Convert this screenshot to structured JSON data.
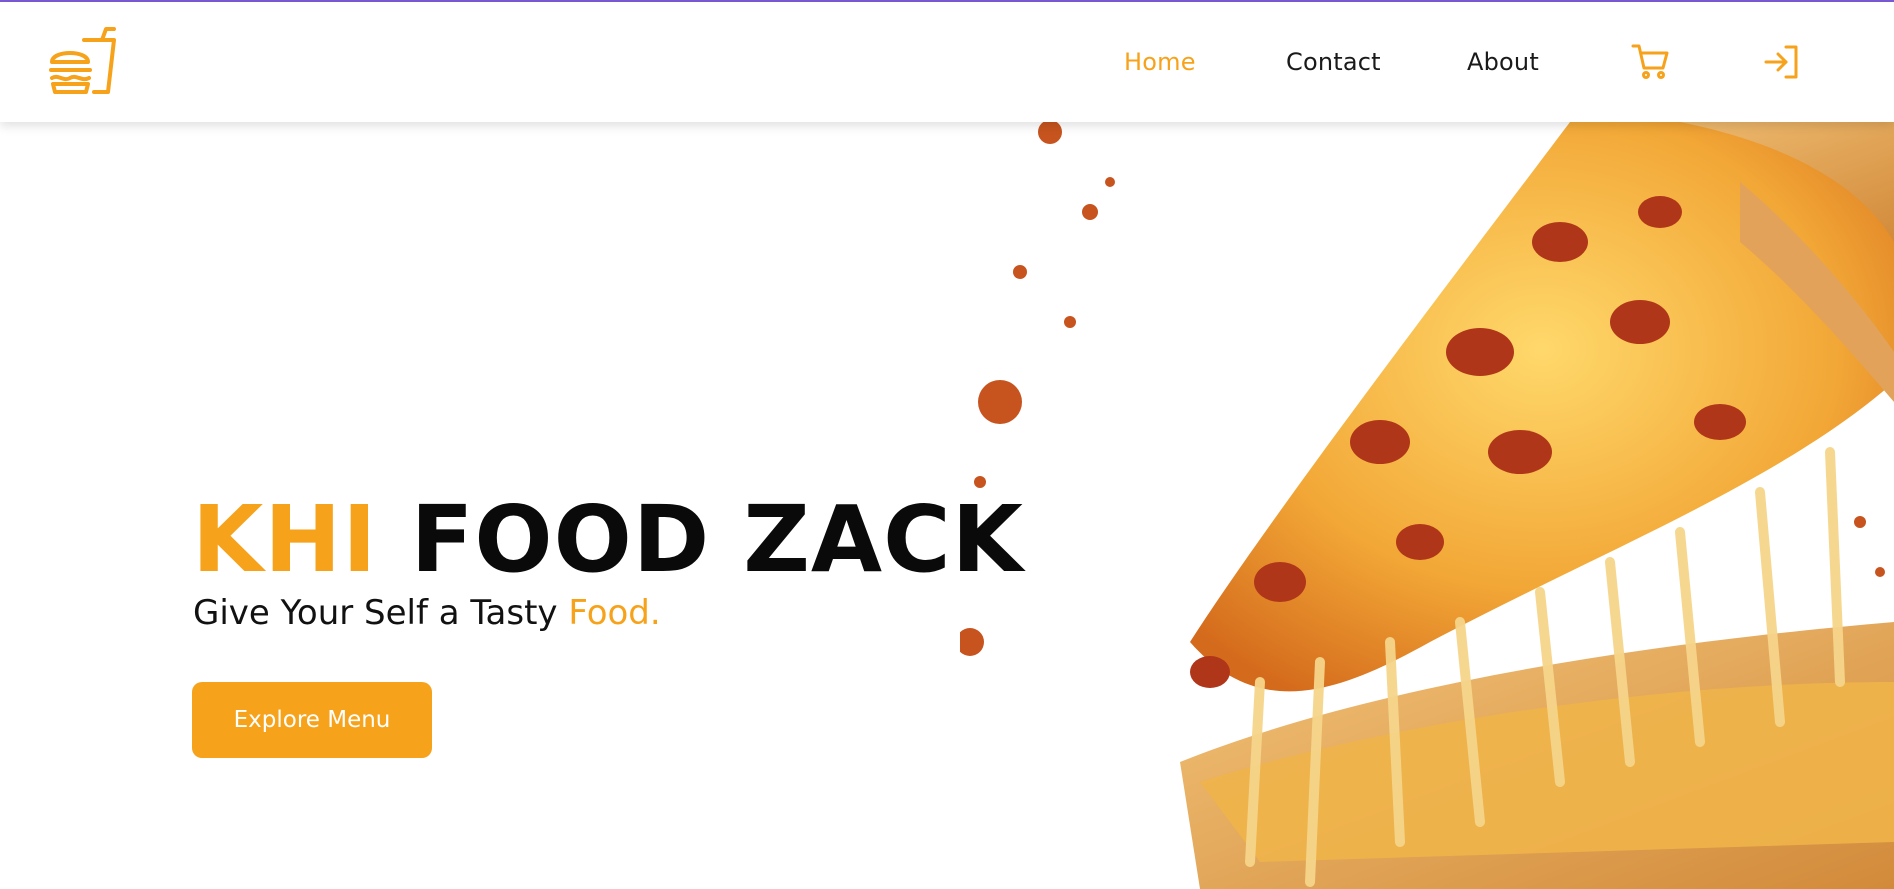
{
  "nav": {
    "logo_icon": "burger-drink-icon",
    "links": [
      {
        "label": "Home",
        "active": true
      },
      {
        "label": "Contact",
        "active": false
      },
      {
        "label": "About",
        "active": false
      }
    ],
    "cart_icon": "cart-icon",
    "login_icon": "login-icon"
  },
  "hero": {
    "title_accent": "KHI",
    "title_rest": "FOOD ZACK",
    "subtitle_plain": "Give Your Self a Tasty",
    "subtitle_accent": "Food.",
    "button_label": "Explore Menu",
    "image": "pizza-slice-cheese-pull"
  },
  "colors": {
    "accent": "#f7a21b",
    "top_border": "#7b5bd6",
    "text": "#0a0a0a",
    "background": "#ffffff"
  }
}
